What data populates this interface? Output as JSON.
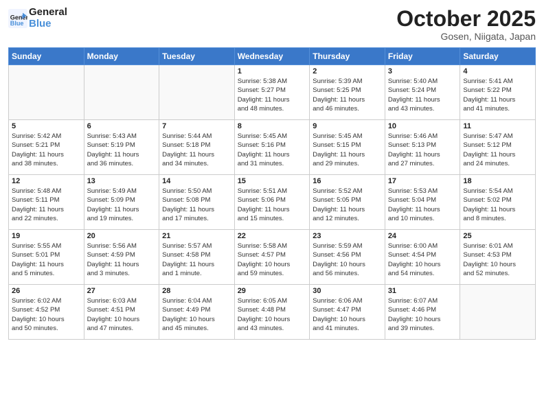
{
  "header": {
    "logo_line1": "General",
    "logo_line2": "Blue",
    "month": "October 2025",
    "location": "Gosen, Niigata, Japan"
  },
  "days_of_week": [
    "Sunday",
    "Monday",
    "Tuesday",
    "Wednesday",
    "Thursday",
    "Friday",
    "Saturday"
  ],
  "weeks": [
    [
      {
        "day": "",
        "info": ""
      },
      {
        "day": "",
        "info": ""
      },
      {
        "day": "",
        "info": ""
      },
      {
        "day": "1",
        "info": "Sunrise: 5:38 AM\nSunset: 5:27 PM\nDaylight: 11 hours\nand 48 minutes."
      },
      {
        "day": "2",
        "info": "Sunrise: 5:39 AM\nSunset: 5:25 PM\nDaylight: 11 hours\nand 46 minutes."
      },
      {
        "day": "3",
        "info": "Sunrise: 5:40 AM\nSunset: 5:24 PM\nDaylight: 11 hours\nand 43 minutes."
      },
      {
        "day": "4",
        "info": "Sunrise: 5:41 AM\nSunset: 5:22 PM\nDaylight: 11 hours\nand 41 minutes."
      }
    ],
    [
      {
        "day": "5",
        "info": "Sunrise: 5:42 AM\nSunset: 5:21 PM\nDaylight: 11 hours\nand 38 minutes."
      },
      {
        "day": "6",
        "info": "Sunrise: 5:43 AM\nSunset: 5:19 PM\nDaylight: 11 hours\nand 36 minutes."
      },
      {
        "day": "7",
        "info": "Sunrise: 5:44 AM\nSunset: 5:18 PM\nDaylight: 11 hours\nand 34 minutes."
      },
      {
        "day": "8",
        "info": "Sunrise: 5:45 AM\nSunset: 5:16 PM\nDaylight: 11 hours\nand 31 minutes."
      },
      {
        "day": "9",
        "info": "Sunrise: 5:45 AM\nSunset: 5:15 PM\nDaylight: 11 hours\nand 29 minutes."
      },
      {
        "day": "10",
        "info": "Sunrise: 5:46 AM\nSunset: 5:13 PM\nDaylight: 11 hours\nand 27 minutes."
      },
      {
        "day": "11",
        "info": "Sunrise: 5:47 AM\nSunset: 5:12 PM\nDaylight: 11 hours\nand 24 minutes."
      }
    ],
    [
      {
        "day": "12",
        "info": "Sunrise: 5:48 AM\nSunset: 5:11 PM\nDaylight: 11 hours\nand 22 minutes."
      },
      {
        "day": "13",
        "info": "Sunrise: 5:49 AM\nSunset: 5:09 PM\nDaylight: 11 hours\nand 19 minutes."
      },
      {
        "day": "14",
        "info": "Sunrise: 5:50 AM\nSunset: 5:08 PM\nDaylight: 11 hours\nand 17 minutes."
      },
      {
        "day": "15",
        "info": "Sunrise: 5:51 AM\nSunset: 5:06 PM\nDaylight: 11 hours\nand 15 minutes."
      },
      {
        "day": "16",
        "info": "Sunrise: 5:52 AM\nSunset: 5:05 PM\nDaylight: 11 hours\nand 12 minutes."
      },
      {
        "day": "17",
        "info": "Sunrise: 5:53 AM\nSunset: 5:04 PM\nDaylight: 11 hours\nand 10 minutes."
      },
      {
        "day": "18",
        "info": "Sunrise: 5:54 AM\nSunset: 5:02 PM\nDaylight: 11 hours\nand 8 minutes."
      }
    ],
    [
      {
        "day": "19",
        "info": "Sunrise: 5:55 AM\nSunset: 5:01 PM\nDaylight: 11 hours\nand 5 minutes."
      },
      {
        "day": "20",
        "info": "Sunrise: 5:56 AM\nSunset: 4:59 PM\nDaylight: 11 hours\nand 3 minutes."
      },
      {
        "day": "21",
        "info": "Sunrise: 5:57 AM\nSunset: 4:58 PM\nDaylight: 11 hours\nand 1 minute."
      },
      {
        "day": "22",
        "info": "Sunrise: 5:58 AM\nSunset: 4:57 PM\nDaylight: 10 hours\nand 59 minutes."
      },
      {
        "day": "23",
        "info": "Sunrise: 5:59 AM\nSunset: 4:56 PM\nDaylight: 10 hours\nand 56 minutes."
      },
      {
        "day": "24",
        "info": "Sunrise: 6:00 AM\nSunset: 4:54 PM\nDaylight: 10 hours\nand 54 minutes."
      },
      {
        "day": "25",
        "info": "Sunrise: 6:01 AM\nSunset: 4:53 PM\nDaylight: 10 hours\nand 52 minutes."
      }
    ],
    [
      {
        "day": "26",
        "info": "Sunrise: 6:02 AM\nSunset: 4:52 PM\nDaylight: 10 hours\nand 50 minutes."
      },
      {
        "day": "27",
        "info": "Sunrise: 6:03 AM\nSunset: 4:51 PM\nDaylight: 10 hours\nand 47 minutes."
      },
      {
        "day": "28",
        "info": "Sunrise: 6:04 AM\nSunset: 4:49 PM\nDaylight: 10 hours\nand 45 minutes."
      },
      {
        "day": "29",
        "info": "Sunrise: 6:05 AM\nSunset: 4:48 PM\nDaylight: 10 hours\nand 43 minutes."
      },
      {
        "day": "30",
        "info": "Sunrise: 6:06 AM\nSunset: 4:47 PM\nDaylight: 10 hours\nand 41 minutes."
      },
      {
        "day": "31",
        "info": "Sunrise: 6:07 AM\nSunset: 4:46 PM\nDaylight: 10 hours\nand 39 minutes."
      },
      {
        "day": "",
        "info": ""
      }
    ]
  ]
}
